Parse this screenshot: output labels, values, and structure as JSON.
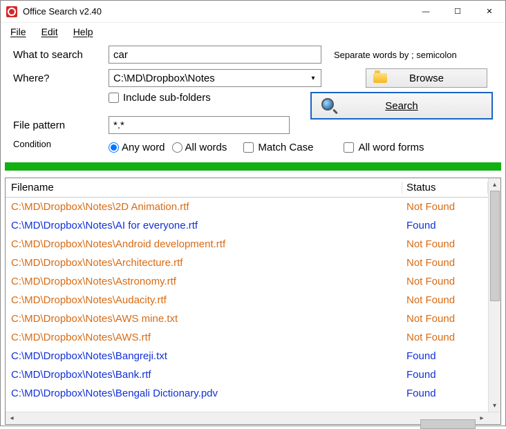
{
  "window": {
    "title": "Office Search v2.40"
  },
  "menu": {
    "file": "File",
    "edit": "Edit",
    "help": "Help"
  },
  "form": {
    "what_label": "What to search",
    "what_value": "car",
    "separate_hint": "Separate words by ; semicolon",
    "where_label": "Where?",
    "where_value": "C:\\MD\\Dropbox\\Notes",
    "browse_label": "Browse",
    "include_sub_label": "Include sub-folders",
    "search_label": "Search",
    "pattern_label": "File pattern",
    "pattern_value": "*.*",
    "condition_label": "Condition",
    "any_word_label": "Any word",
    "all_words_label": "All words",
    "match_case_label": "Match Case",
    "all_forms_label": "All word forms"
  },
  "results": {
    "col_filename": "Filename",
    "col_status": "Status",
    "rows": [
      {
        "file": "C:\\MD\\Dropbox\\Notes\\2D Animation.rtf",
        "status": "Not Found",
        "found": false
      },
      {
        "file": "C:\\MD\\Dropbox\\Notes\\AI for everyone.rtf",
        "status": "Found",
        "found": true
      },
      {
        "file": "C:\\MD\\Dropbox\\Notes\\Android development.rtf",
        "status": "Not Found",
        "found": false
      },
      {
        "file": "C:\\MD\\Dropbox\\Notes\\Architecture.rtf",
        "status": "Not Found",
        "found": false
      },
      {
        "file": "C:\\MD\\Dropbox\\Notes\\Astronomy.rtf",
        "status": "Not Found",
        "found": false
      },
      {
        "file": "C:\\MD\\Dropbox\\Notes\\Audacity.rtf",
        "status": "Not Found",
        "found": false
      },
      {
        "file": "C:\\MD\\Dropbox\\Notes\\AWS mine.txt",
        "status": "Not Found",
        "found": false
      },
      {
        "file": "C:\\MD\\Dropbox\\Notes\\AWS.rtf",
        "status": "Not Found",
        "found": false
      },
      {
        "file": "C:\\MD\\Dropbox\\Notes\\Bangreji.txt",
        "status": "Found",
        "found": true
      },
      {
        "file": "C:\\MD\\Dropbox\\Notes\\Bank.rtf",
        "status": "Found",
        "found": true
      },
      {
        "file": "C:\\MD\\Dropbox\\Notes\\Bengali Dictionary.pdv",
        "status": "Found",
        "found": true
      }
    ]
  }
}
